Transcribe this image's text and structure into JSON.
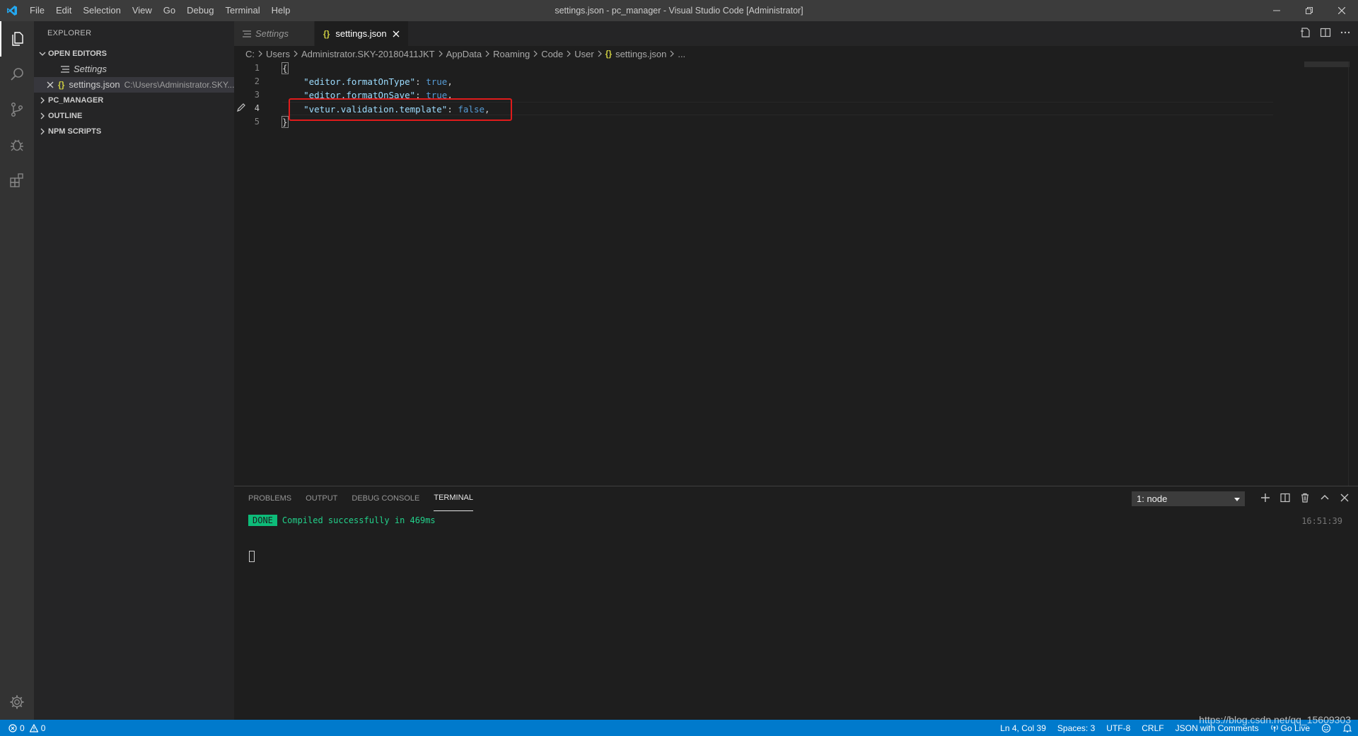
{
  "window": {
    "title": "settings.json - pc_manager - Visual Studio Code [Administrator]"
  },
  "menu": [
    "File",
    "Edit",
    "Selection",
    "View",
    "Go",
    "Debug",
    "Terminal",
    "Help"
  ],
  "sidebar": {
    "title": "EXPLORER",
    "open_editors_label": "OPEN EDITORS",
    "open_editors": [
      {
        "name": "Settings",
        "path": ""
      },
      {
        "name": "settings.json",
        "path": "C:\\Users\\Administrator.SKY..."
      }
    ],
    "sections": [
      "PC_MANAGER",
      "OUTLINE",
      "NPM SCRIPTS"
    ]
  },
  "tabs": [
    {
      "label": "Settings",
      "icon": "settings-lines-icon",
      "active": false
    },
    {
      "label": "settings.json",
      "icon": "json-braces-icon",
      "active": true
    }
  ],
  "breadcrumb": [
    "C:",
    "Users",
    "Administrator.SKY-20180411JKT",
    "AppData",
    "Roaming",
    "Code",
    "User",
    "settings.json",
    "..."
  ],
  "editor": {
    "line_numbers": [
      "1",
      "2",
      "3",
      "4",
      "5"
    ],
    "lines": [
      {
        "open": "{"
      },
      {
        "key": "\"editor.formatOnType\"",
        "sep": ": ",
        "value": "true",
        "end": ","
      },
      {
        "key": "\"editor.formatOnSave\"",
        "sep": ": ",
        "value": "true",
        "end": ","
      },
      {
        "key": "\"vetur.validation.template\"",
        "sep": ": ",
        "value": "false",
        "end": ","
      },
      {
        "open": "}"
      }
    ]
  },
  "panel": {
    "tabs": [
      "PROBLEMS",
      "OUTPUT",
      "DEBUG CONSOLE",
      "TERMINAL"
    ],
    "active_tab": "TERMINAL",
    "terminal_select": "1: node",
    "badge": "DONE",
    "message": "Compiled successfully in 469ms",
    "time": "16:51:39"
  },
  "status": {
    "errors": "0",
    "warnings": "0",
    "position": "Ln 4, Col 39",
    "spaces": "Spaces: 3",
    "encoding": "UTF-8",
    "eol": "CRLF",
    "language": "JSON with Comments",
    "go_live": "Go Live"
  },
  "watermark": "https://blog.csdn.net/qq_15609303",
  "colors": {
    "accent": "#007acc",
    "highlight_box": "#e01b1b",
    "done_badge": "#0dbc79"
  }
}
